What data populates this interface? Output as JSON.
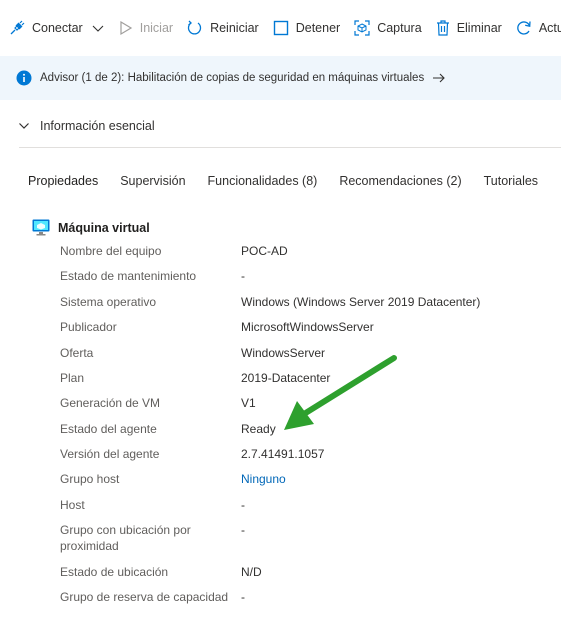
{
  "toolbar": {
    "conectar": "Conectar",
    "iniciar": "Iniciar",
    "reiniciar": "Reiniciar",
    "detener": "Detener",
    "captura": "Captura",
    "eliminar": "Eliminar",
    "actualizar": "Actual"
  },
  "banner": {
    "text": "Advisor (1 de 2): Habilitación de copias de seguridad en máquinas virtuales"
  },
  "essentials": {
    "label": "Información esencial"
  },
  "tabs": [
    {
      "label": "Propiedades",
      "active": true
    },
    {
      "label": "Supervisión"
    },
    {
      "label": "Funcionalidades (8)"
    },
    {
      "label": "Recomendaciones (2)"
    },
    {
      "label": "Tutoriales"
    }
  ],
  "section": {
    "title": "Máquina virtual"
  },
  "properties": [
    {
      "key": "Nombre del equipo",
      "value": "POC-AD"
    },
    {
      "key": "Estado de mantenimiento",
      "value": "-"
    },
    {
      "key": "Sistema operativo",
      "value": "Windows (Windows Server 2019 Datacenter)"
    },
    {
      "key": "Publicador",
      "value": "MicrosoftWindowsServer"
    },
    {
      "key": "Oferta",
      "value": "WindowsServer"
    },
    {
      "key": "Plan",
      "value": "2019-Datacenter"
    },
    {
      "key": "Generación de VM",
      "value": "V1"
    },
    {
      "key": "Estado del agente",
      "value": "Ready"
    },
    {
      "key": "Versión del agente",
      "value": "2.7.41491.1057"
    },
    {
      "key": "Grupo host",
      "value": "Ninguno"
    },
    {
      "key": "Host",
      "value": "-"
    },
    {
      "key": "Grupo con ubicación por proximidad",
      "value": "-"
    },
    {
      "key": "Estado de ubicación",
      "value": "N/D"
    },
    {
      "key": "Grupo de reserva de capacidad",
      "value": "-"
    }
  ],
  "colors": {
    "accent": "#0078d4",
    "link": "#0067b8",
    "banner_bg": "#eff6fc",
    "annotation_arrow": "#2ea02e"
  }
}
